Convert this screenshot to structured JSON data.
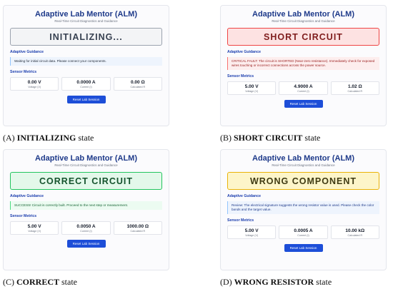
{
  "panels": [
    {
      "title": "Adaptive Lab Mentor (ALM)",
      "subtitle": "Real-Time Circuit Diagnostics and Guidance",
      "state_text": "INITIALIZING...",
      "state_bg": "#f3f4f6",
      "state_border": "#9ca3af",
      "state_color": "#374151",
      "guidance_heading": "Adaptive Guidance",
      "guidance_text": "Waiting for initial circuit data. Please connect your components.",
      "guide_bg": "#eef4fd",
      "guide_border": "#93c5fd",
      "guide_color": "#1f2937",
      "metrics_heading": "Sensor Metrics",
      "voltage": "0.00 V",
      "voltage_label": "Voltage (V)",
      "current": "0.0000 A",
      "current_label": "Current (I)",
      "resistance": "0.00 Ω",
      "resistance_label": "Calculated R",
      "reset_label": "Reset Lab Session",
      "caption_prefix": "(A) ",
      "caption_bold": "INITIALIZING",
      "caption_suffix": " state"
    },
    {
      "title": "Adaptive Lab Mentor (ALM)",
      "subtitle": "Real-Time Circuit Diagnostics and Guidance",
      "state_text": "SHORT CIRCUIT",
      "state_bg": "#fde2e2",
      "state_border": "#ef4444",
      "state_color": "#7f1d1d",
      "guidance_heading": "Adaptive Guidance",
      "guidance_text": "CRITICAL FAULT: The circuit is SHORTED (Near-zero resistance). Immediately check for exposed wires touching or incorrect connections across the power source.",
      "guide_bg": "#fdeeee",
      "guide_border": "#f87171",
      "guide_color": "#991b1b",
      "metrics_heading": "Sensor Metrics",
      "voltage": "5.00 V",
      "voltage_label": "Voltage (V)",
      "current": "4.9000 A",
      "current_label": "Current (I)",
      "resistance": "1.02 Ω",
      "resistance_label": "Calculated R",
      "reset_label": "Reset Lab Session",
      "caption_prefix": "(B) ",
      "caption_bold": "SHORT CIRCUIT",
      "caption_suffix": " state"
    },
    {
      "title": "Adaptive Lab Mentor (ALM)",
      "subtitle": "Real-Time Circuit Diagnostics and Guidance",
      "state_text": "CORRECT CIRCUIT",
      "state_bg": "#e3f8ea",
      "state_border": "#22c55e",
      "state_color": "#14532d",
      "guidance_heading": "Adaptive Guidance",
      "guidance_text": "SUCCESS! Circuit is correctly built. Proceed to the next step or measurement.",
      "guide_bg": "#ecfbf1",
      "guide_border": "#4ade80",
      "guide_color": "#166534",
      "metrics_heading": "Sensor Metrics",
      "voltage": "5.00 V",
      "voltage_label": "Voltage (V)",
      "current": "0.0050 A",
      "current_label": "Current (I)",
      "resistance": "1000.00 Ω",
      "resistance_label": "Calculated R",
      "reset_label": "Reset Lab Session",
      "caption_prefix": "(C) ",
      "caption_bold": "CORRECT",
      "caption_suffix": " state"
    },
    {
      "title": "Adaptive Lab Mentor (ALM)",
      "subtitle": "Real-Time Circuit Diagnostics and Guidance",
      "state_text": "WRONG COMPONENT",
      "state_bg": "#fdf5c9",
      "state_border": "#eab308",
      "state_color": "#3f3a12",
      "guidance_heading": "Adaptive Guidance",
      "guidance_text": "Review: The electrical signature suggests the wrong resistor value is used. Please check the color bands and the target value.",
      "guide_bg": "#eef4fd",
      "guide_border": "#93c5fd",
      "guide_color": "#1e3a8a",
      "metrics_heading": "Sensor Metrics",
      "voltage": "5.00 V",
      "voltage_label": "Voltage (V)",
      "current": "0.0005 A",
      "current_label": "Current (I)",
      "resistance": "10.00 kΩ",
      "resistance_label": "Calculated R",
      "reset_label": "Reset Lab Session",
      "caption_prefix": "(D) ",
      "caption_bold": "WRONG RESISTOR",
      "caption_suffix": " state"
    }
  ]
}
